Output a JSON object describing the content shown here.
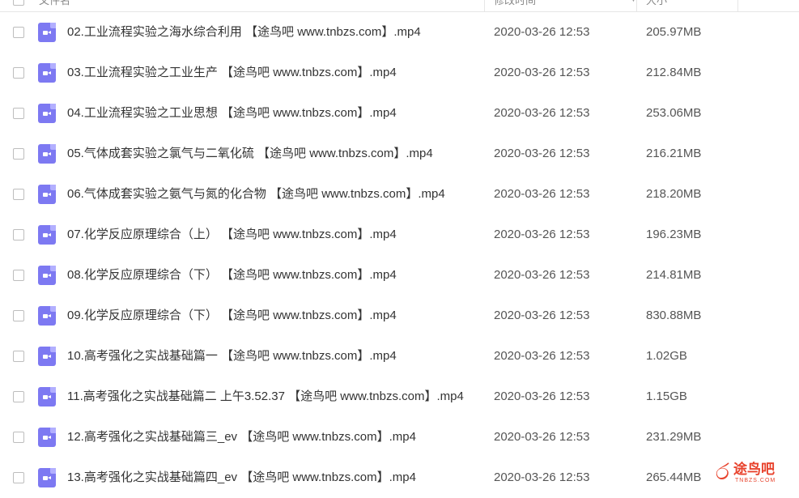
{
  "header": {
    "col_name": "文件名",
    "col_modified": "修改时间",
    "col_size": "大小"
  },
  "files": [
    {
      "name": "02.工业流程实验之海水综合利用 【途鸟吧 www.tnbzs.com】.mp4",
      "modified": "2020-03-26 12:53",
      "size": "205.97MB"
    },
    {
      "name": "03.工业流程实验之工业生产 【途鸟吧 www.tnbzs.com】.mp4",
      "modified": "2020-03-26 12:53",
      "size": "212.84MB"
    },
    {
      "name": "04.工业流程实验之工业思想 【途鸟吧 www.tnbzs.com】.mp4",
      "modified": "2020-03-26 12:53",
      "size": "253.06MB"
    },
    {
      "name": "05.气体成套实验之氯气与二氧化硫 【途鸟吧 www.tnbzs.com】.mp4",
      "modified": "2020-03-26 12:53",
      "size": "216.21MB"
    },
    {
      "name": "06.气体成套实验之氨气与氮的化合物 【途鸟吧 www.tnbzs.com】.mp4",
      "modified": "2020-03-26 12:53",
      "size": "218.20MB"
    },
    {
      "name": "07.化学反应原理综合（上） 【途鸟吧 www.tnbzs.com】.mp4",
      "modified": "2020-03-26 12:53",
      "size": "196.23MB"
    },
    {
      "name": "08.化学反应原理综合（下） 【途鸟吧 www.tnbzs.com】.mp4",
      "modified": "2020-03-26 12:53",
      "size": "214.81MB"
    },
    {
      "name": "09.化学反应原理综合（下） 【途鸟吧 www.tnbzs.com】.mp4",
      "modified": "2020-03-26 12:53",
      "size": "830.88MB"
    },
    {
      "name": "10.高考强化之实战基础篇一 【途鸟吧 www.tnbzs.com】.mp4",
      "modified": "2020-03-26 12:53",
      "size": "1.02GB"
    },
    {
      "name": "11.高考强化之实战基础篇二 上午3.52.37 【途鸟吧 www.tnbzs.com】.mp4",
      "modified": "2020-03-26 12:53",
      "size": "1.15GB"
    },
    {
      "name": "12.高考强化之实战基础篇三_ev 【途鸟吧 www.tnbzs.com】.mp4",
      "modified": "2020-03-26 12:53",
      "size": "231.29MB"
    },
    {
      "name": "13.高考强化之实战基础篇四_ev 【途鸟吧 www.tnbzs.com】.mp4",
      "modified": "2020-03-26 12:53",
      "size": "265.44MB"
    }
  ],
  "icons": {
    "file_icon": "video-file-icon",
    "checkbox": "checkbox-icon"
  },
  "colors": {
    "file_icon": "#7d79f2",
    "watermark": "#e8432d"
  },
  "watermark": {
    "text": "途鸟吧",
    "sub": "TNBZS.COM"
  }
}
